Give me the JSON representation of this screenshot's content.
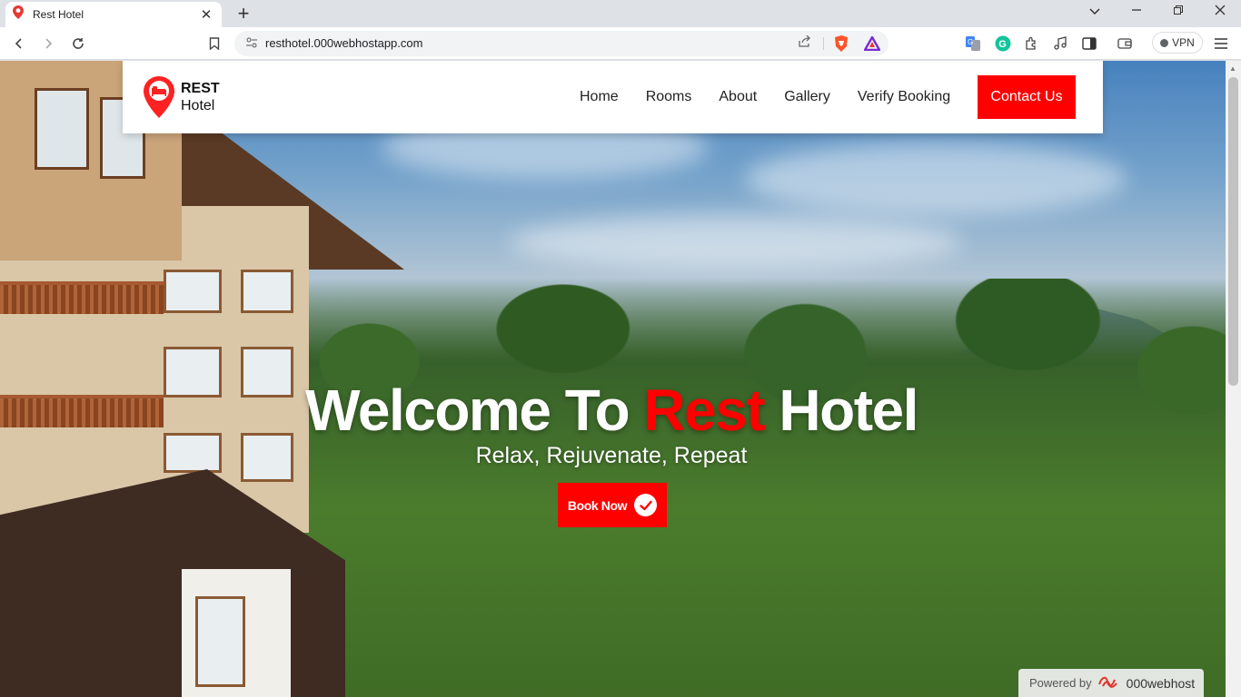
{
  "browser": {
    "tab_title": "Rest Hotel",
    "tab_close": "✕",
    "new_tab": "+",
    "url": "resthotel.000webhostapp.com",
    "vpn_label": "VPN"
  },
  "nav": {
    "logo_line1": "REST",
    "logo_line2": "Hotel",
    "links": [
      "Home",
      "Rooms",
      "About",
      "Gallery",
      "Verify Booking"
    ],
    "contact_label": "Contact Us"
  },
  "hero": {
    "title_before": "Welcome To ",
    "title_accent": "Rest",
    "title_after": " Hotel",
    "subtitle": "Relax, Rejuvenate, Repeat",
    "book_label": "Book Now"
  },
  "footer_badge": {
    "powered_label": "Powered by",
    "brand": "000webhost"
  },
  "colors": {
    "accent": "#ff0000",
    "chrome_bg": "#dee1e6",
    "urlbar_bg": "#f1f3f4"
  },
  "icons": {
    "tab": "location-pin-icon",
    "back": "back-arrow-icon",
    "forward": "forward-arrow-icon",
    "reload": "reload-icon",
    "bookmark": "bookmark-icon",
    "share": "share-icon",
    "book_check": "check-circle-icon"
  }
}
